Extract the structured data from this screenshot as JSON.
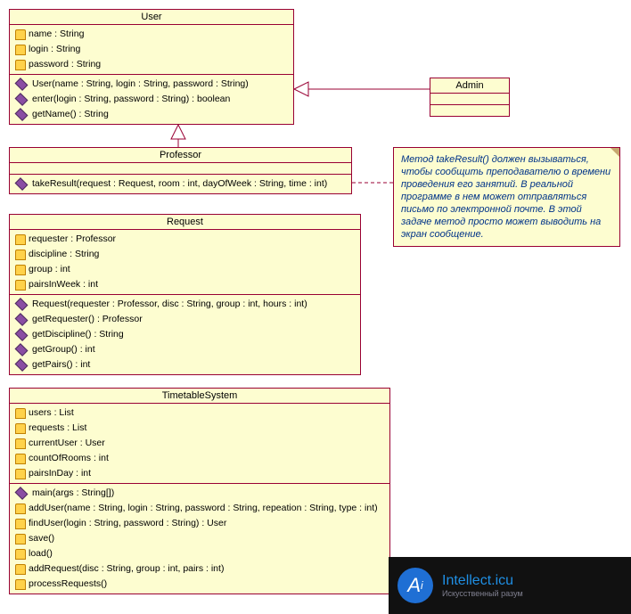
{
  "classes": {
    "user": {
      "title": "User",
      "attrs": [
        "name : String",
        "login : String",
        "password : String"
      ],
      "ops": [
        "User(name : String, login : String, password : String)",
        "enter(login : String, password : String) : boolean",
        "getName() : String"
      ]
    },
    "admin": {
      "title": "Admin"
    },
    "professor": {
      "title": "Professor",
      "ops": [
        "takeResult(request : Request, room : int, dayOfWeek : String, time : int)"
      ]
    },
    "request": {
      "title": "Request",
      "attrs": [
        "requester : Professor",
        "discipline : String",
        "group : int",
        "pairsInWeek : int"
      ],
      "ops": [
        "Request(requester : Professor, disc : String, group : int, hours : int)",
        "getRequester() : Professor",
        "getDiscipline() : String",
        "getGroup() : int",
        "getPairs() : int"
      ]
    },
    "timetable": {
      "title": "TimetableSystem",
      "attrs": [
        "users : List",
        "requests : List",
        "currentUser : User",
        "countOfRooms : int",
        "pairsInDay : int"
      ],
      "ops": [
        "main(args : String[])",
        "addUser(name : String, login : String, password : String, repeation : String, type : int)",
        "findUser(login : String, password : String) : User",
        "save()",
        "load()",
        "addRequest(disc : String, group : int, pairs : int)",
        "processRequests()"
      ]
    }
  },
  "note": "Метод takeResult() должен вызываться, чтобы сообщить преподавателю о времени проведения его занятий. В реальной программе в нем может отправляться письмо по электронной почте. В этой задаче метод просто может выводить на экран сообщение.",
  "footer": {
    "title": "Intellect.icu",
    "subtitle": "Искусственный  разум"
  }
}
